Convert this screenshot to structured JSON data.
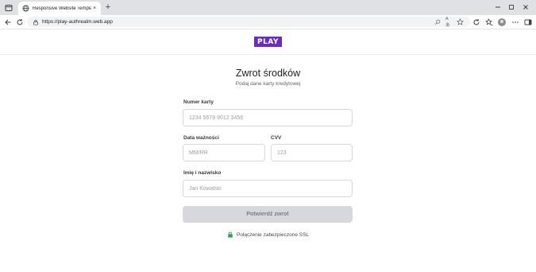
{
  "browser": {
    "tab_title": "Responsive Website Template De",
    "tab_close": "×",
    "new_tab": "+",
    "url": "https://play-authrealm.web.app",
    "read_aloud_label": "Aあ",
    "icons": [
      "window-menu-icon",
      "favicon-globe-icon",
      "back-icon",
      "refresh-icon",
      "site-info-icon",
      "search-icon",
      "read-aloud-icon",
      "favorite-star-icon",
      "extensions-icon",
      "favorites-list-icon",
      "profile-avatar",
      "more-menu-icon",
      "sidebar-icon",
      "minimize-icon",
      "maximize-icon",
      "close-window-icon"
    ]
  },
  "header": {
    "logo_text": "PLAY",
    "brand_color": "#6b2bbf"
  },
  "form": {
    "title": "Zwrot środków",
    "subtitle": "Podaj dane karty kredytowej",
    "card_number": {
      "label": "Numer karty",
      "placeholder": "1234 5678 9012 3456",
      "value": ""
    },
    "expiry": {
      "label": "Data ważności",
      "placeholder": "MM/RR",
      "value": ""
    },
    "cvv": {
      "label": "CVV",
      "placeholder": "123",
      "value": ""
    },
    "name": {
      "label": "Imię i nazwisko",
      "placeholder": "Jan Kowalski",
      "value": ""
    },
    "submit_label": "Potwierdź zwrot",
    "ssl_text": "Połączenie zabezpieczone SSL",
    "ssl_color": "#2e9e4f"
  }
}
